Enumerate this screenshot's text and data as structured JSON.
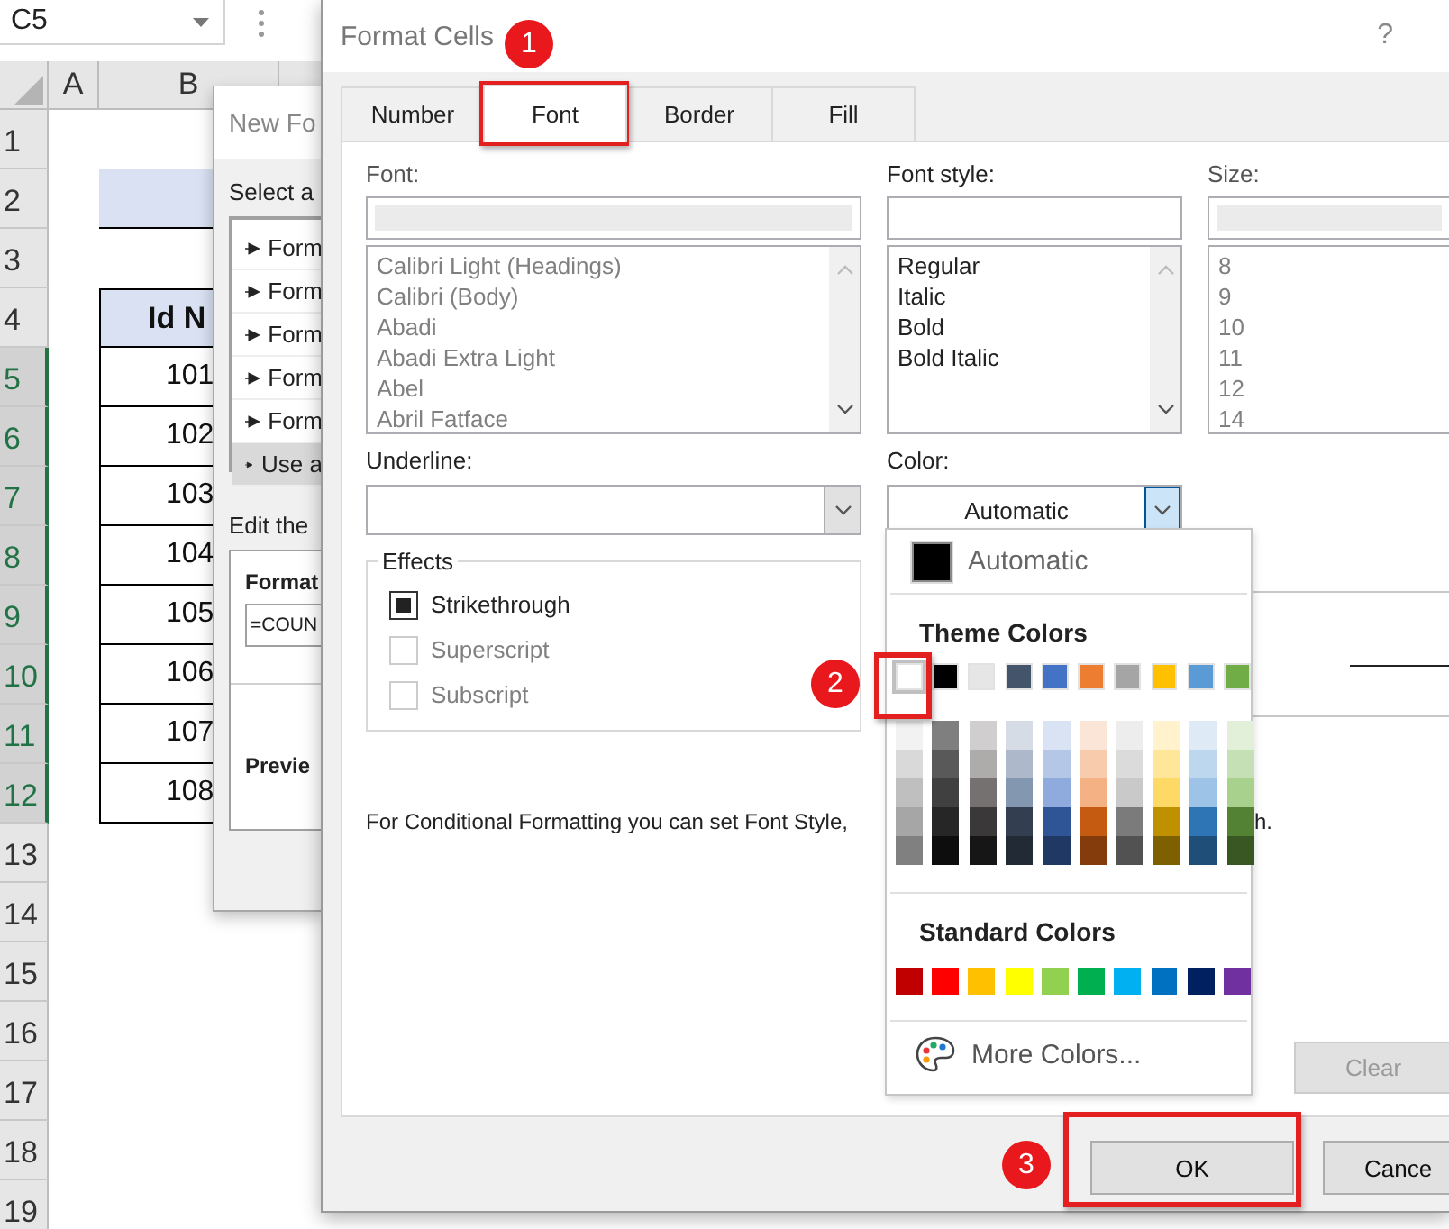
{
  "name_box": {
    "value": "C5"
  },
  "sheet": {
    "columns": [
      "A",
      "B"
    ],
    "rows": [
      {
        "header": "1",
        "selected": false,
        "kind": "blank"
      },
      {
        "header": "2",
        "selected": false,
        "kind": "title-band"
      },
      {
        "header": "3",
        "selected": false,
        "kind": "blank"
      },
      {
        "header": "4",
        "selected": false,
        "kind": "header",
        "value": "Id N"
      },
      {
        "header": "5",
        "selected": true,
        "kind": "data",
        "value": "101"
      },
      {
        "header": "6",
        "selected": true,
        "kind": "data",
        "value": "102"
      },
      {
        "header": "7",
        "selected": true,
        "kind": "data",
        "value": "103"
      },
      {
        "header": "8",
        "selected": true,
        "kind": "data",
        "value": "104"
      },
      {
        "header": "9",
        "selected": true,
        "kind": "data",
        "value": "105"
      },
      {
        "header": "10",
        "selected": true,
        "kind": "data",
        "value": "106"
      },
      {
        "header": "11",
        "selected": true,
        "kind": "data",
        "value": "107"
      },
      {
        "header": "12",
        "selected": true,
        "kind": "data",
        "value": "108"
      },
      {
        "header": "13",
        "selected": false,
        "kind": "blank"
      },
      {
        "header": "14",
        "selected": false,
        "kind": "blank"
      },
      {
        "header": "15",
        "selected": false,
        "kind": "blank"
      },
      {
        "header": "16",
        "selected": false,
        "kind": "blank"
      },
      {
        "header": "17",
        "selected": false,
        "kind": "blank"
      },
      {
        "header": "18",
        "selected": false,
        "kind": "blank"
      },
      {
        "header": "19",
        "selected": false,
        "kind": "blank"
      }
    ]
  },
  "new_formatting_rule": {
    "title": "New Fo",
    "rule_type_label": "Select a",
    "rule_types": [
      {
        "label": "Form",
        "selected": false
      },
      {
        "label": "Form",
        "selected": false
      },
      {
        "label": "Form",
        "selected": false
      },
      {
        "label": "Form",
        "selected": false
      },
      {
        "label": "Form",
        "selected": false
      },
      {
        "label": "Use a",
        "selected": true
      }
    ],
    "edit_label": "Edit the",
    "formula_label": "Format",
    "formula": "=COUN",
    "preview_label": "Previe"
  },
  "format_cells": {
    "title": "Format Cells",
    "help": "?",
    "tabs": [
      {
        "label": "Number",
        "selected": false
      },
      {
        "label": "Font",
        "selected": true
      },
      {
        "label": "Border",
        "selected": false
      },
      {
        "label": "Fill",
        "selected": false
      }
    ],
    "font": {
      "label": "Font:",
      "disabled": true,
      "items": [
        "Calibri Light (Headings)",
        "Calibri (Body)",
        "Abadi",
        "Abadi Extra Light",
        "Abel",
        "Abril Fatface"
      ]
    },
    "font_style": {
      "label": "Font style:",
      "disabled": false,
      "items": [
        "Regular",
        "Italic",
        "Bold",
        "Bold Italic"
      ]
    },
    "size": {
      "label": "Size:",
      "disabled": true,
      "items": [
        "8",
        "9",
        "10",
        "11",
        "12",
        "14"
      ]
    },
    "underline": {
      "label": "Underline:"
    },
    "color": {
      "label": "Color:",
      "value": "Automatic",
      "expanded": true
    },
    "effects": {
      "title": "Effects",
      "items": [
        {
          "label": "Strikethrough",
          "checked": true,
          "disabled": false
        },
        {
          "label": "Superscript",
          "checked": false,
          "disabled": true
        },
        {
          "label": "Subscript",
          "checked": false,
          "disabled": true
        }
      ]
    },
    "note": {
      "text": "For Conditional Formatting you can set Font Style,",
      "tail": "h."
    },
    "clear_button": {
      "label": "Clear",
      "disabled": true
    },
    "buttons": [
      {
        "label": "OK"
      },
      {
        "label": "Cance"
      }
    ]
  },
  "color_palette": {
    "automatic": "Automatic",
    "theme_title": "Theme Colors",
    "theme_colors": [
      {
        "color": "#ffffff",
        "selected": true,
        "shades": [
          {
            "color": "#f2f2f2"
          },
          {
            "color": "#d9d9d9"
          },
          {
            "color": "#bfbfbf"
          },
          {
            "color": "#a6a6a6"
          },
          {
            "color": "#808080"
          }
        ]
      },
      {
        "color": "#000000",
        "selected": false,
        "shades": [
          {
            "color": "#7f7f7f"
          },
          {
            "color": "#595959"
          },
          {
            "color": "#404040"
          },
          {
            "color": "#262626"
          },
          {
            "color": "#0d0d0d"
          }
        ]
      },
      {
        "color": "#e7e6e6",
        "selected": false,
        "shades": [
          {
            "color": "#d0cece"
          },
          {
            "color": "#aeabab"
          },
          {
            "color": "#757171"
          },
          {
            "color": "#3a3838"
          },
          {
            "color": "#171616"
          }
        ]
      },
      {
        "color": "#44546a",
        "selected": false,
        "shades": [
          {
            "color": "#d6dce5"
          },
          {
            "color": "#adb9ca"
          },
          {
            "color": "#8497b0"
          },
          {
            "color": "#333f50"
          },
          {
            "color": "#222a35"
          }
        ]
      },
      {
        "color": "#4472c4",
        "selected": false,
        "shades": [
          {
            "color": "#dae3f3"
          },
          {
            "color": "#b4c7e7"
          },
          {
            "color": "#8faadc"
          },
          {
            "color": "#2f5597"
          },
          {
            "color": "#203864"
          }
        ]
      },
      {
        "color": "#ed7d31",
        "selected": false,
        "shades": [
          {
            "color": "#fbe5d6"
          },
          {
            "color": "#f8cbad"
          },
          {
            "color": "#f4b183"
          },
          {
            "color": "#c55a11"
          },
          {
            "color": "#843c0c"
          }
        ]
      },
      {
        "color": "#a5a5a5",
        "selected": false,
        "shades": [
          {
            "color": "#ededed"
          },
          {
            "color": "#dbdbdb"
          },
          {
            "color": "#c9c9c9"
          },
          {
            "color": "#7b7b7b"
          },
          {
            "color": "#525252"
          }
        ]
      },
      {
        "color": "#ffc000",
        "selected": false,
        "shades": [
          {
            "color": "#fff2cc"
          },
          {
            "color": "#ffe699"
          },
          {
            "color": "#ffd966"
          },
          {
            "color": "#bf9000"
          },
          {
            "color": "#7f6000"
          }
        ]
      },
      {
        "color": "#5b9bd5",
        "selected": false,
        "shades": [
          {
            "color": "#deebf7"
          },
          {
            "color": "#bdd7ee"
          },
          {
            "color": "#9dc3e6"
          },
          {
            "color": "#2e75b6"
          },
          {
            "color": "#1f4e79"
          }
        ]
      },
      {
        "color": "#70ad47",
        "selected": false,
        "shades": [
          {
            "color": "#e2f0d9"
          },
          {
            "color": "#c5e0b4"
          },
          {
            "color": "#a9d18e"
          },
          {
            "color": "#548235"
          },
          {
            "color": "#385723"
          }
        ]
      }
    ],
    "standard_title": "Standard Colors",
    "standard_colors": [
      {
        "color": "#c00000"
      },
      {
        "color": "#ff0000"
      },
      {
        "color": "#ffc000"
      },
      {
        "color": "#ffff00"
      },
      {
        "color": "#92d050"
      },
      {
        "color": "#00b050"
      },
      {
        "color": "#00b0f0"
      },
      {
        "color": "#0070c0"
      },
      {
        "color": "#002060"
      },
      {
        "color": "#7030a0"
      }
    ],
    "more": "More Colors..."
  },
  "annotations": [
    {
      "label": "1"
    },
    {
      "label": "2"
    },
    {
      "label": "3"
    }
  ]
}
